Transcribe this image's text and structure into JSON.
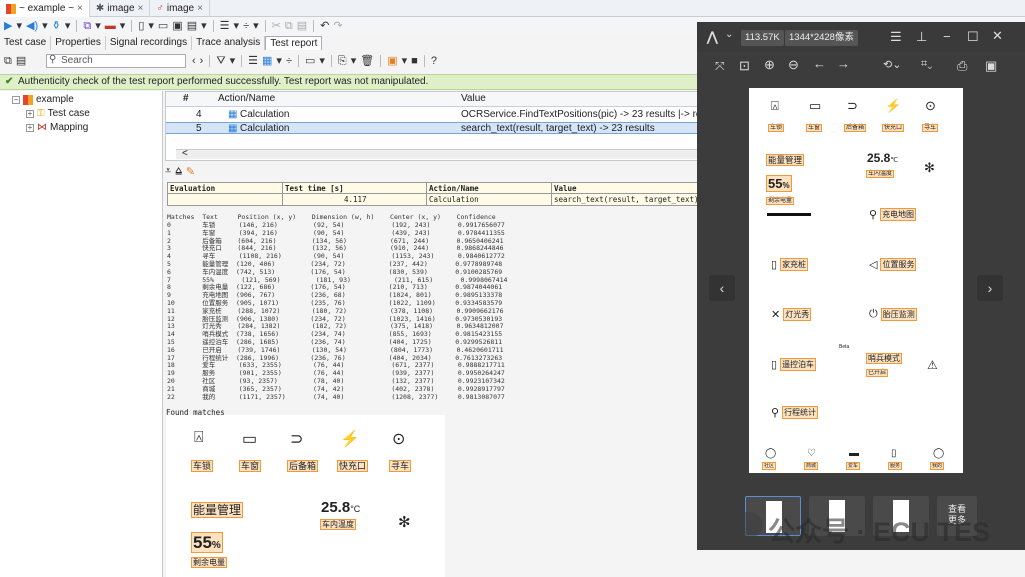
{
  "window_tabs": [
    {
      "label": "~ example ~",
      "icon": "app-grid-icon",
      "active": true
    },
    {
      "label": "image",
      "icon": "image-icon",
      "active": false
    },
    {
      "label": "image",
      "icon": "image-icon",
      "active": false
    }
  ],
  "subtabs": [
    "Test case",
    "Properties",
    "Signal recordings",
    "Trace analysis",
    "Test report"
  ],
  "search": {
    "placeholder": "Search"
  },
  "banner": "Authenticity check of the test report performed successfully. Test report was not manipulated.",
  "tree": {
    "root": "example",
    "children": [
      "Test case",
      "Mapping"
    ]
  },
  "table": {
    "headers": [
      "#",
      "Action/Name",
      "Value"
    ],
    "rows": [
      {
        "num": "4",
        "name": "Calculation",
        "value": "OCRService.FindTextPositions(pic) -> 23 results |-> result"
      },
      {
        "num": "5",
        "name": "Calculation",
        "value": "search_text(result, target_text) -> 23 results"
      }
    ],
    "scroll_arrow": "<",
    "right_header_fragment": "et"
  },
  "evaluation": {
    "headers": [
      "Evaluation",
      "Test time [s]",
      "Action/Name",
      "Value"
    ],
    "row": {
      "eval": "",
      "time": "4.117",
      "action": "Calculation",
      "value": "search_text(result, target_text) -"
    }
  },
  "matches": {
    "header": "Matches  Text     Position (x, y)    Dimension (w, h)    Center (x, y)    Confidence",
    "rows": [
      "0        车锁      (146, 216)         (92, 54)            (192, 243)       0.9917656077",
      "1        车窗      (394, 216)         (90, 54)            (439, 243)       0.9784411355",
      "2        后备箱    (604, 216)         (134, 56)           (671, 244)       0.9650406241",
      "3        快充口    (844, 216)         (132, 56)           (910, 244)       0.9868244846",
      "4        寻车      (1108, 216)        (90, 54)            (1153, 243)      0.9840612772",
      "5        能量管理  (120, 406)         (234, 72)           (237, 442)       0.9778989748",
      "6        车内温度  (742, 513)         (176, 54)           (830, 539)       0.9100285769",
      "7        55%       (121, 569)         (181, 93)           (211, 615)       0.9998067414",
      "8        剩余电量  (122, 686)         (176, 54)           (210, 713)       0.9874044061",
      "9        充电地图  (906, 767)         (236, 68)           (1024, 801)      0.9895133378",
      "10       位置服务  (905, 1071)        (235, 76)           (1022, 1109)     0.9334583579",
      "11       家充桩    (288, 1072)        (180, 72)           (378, 1108)      0.9909662176",
      "12       胎压监测  (906, 1380)        (234, 72)           (1023, 1416)     0.9730530193",
      "13       灯光秀    (284, 1382)        (182, 72)           (375, 1418)      0.9634812007",
      "14       哨兵模式  (738, 1656)        (234, 74)           (855, 1693)      0.9815423155",
      "15       遥控泊车  (286, 1685)        (236, 74)           (404, 1725)      0.9299526811",
      "16       已开启    (739, 1746)        (130, 54)           (804, 1773)      0.4620601711",
      "17       行程统计  (286, 1996)        (236, 76)           (404, 2034)      0.7613273263",
      "18       爱车      (633, 2355)        (76, 44)            (671, 2377)      0.9888217711",
      "19       服务      (901, 2355)        (76, 44)            (939, 2377)      0.9950264247",
      "20       社区      (93, 2357)         (78, 40)            (132, 2377)      0.9923107342",
      "21       商城      (365, 2357)        (74, 42)            (402, 2378)      0.9928917797",
      "22       我的      (1171, 2357)       (74, 40)            (1208, 2377)     0.9813087077"
    ]
  },
  "found_label": "Found matches",
  "shot": {
    "icons": [
      {
        "label": "车锁",
        "icon": "car-lock-icon"
      },
      {
        "label": "车窗",
        "icon": "car-window-icon"
      },
      {
        "label": "后备箱",
        "icon": "trunk-icon"
      },
      {
        "label": "快充口",
        "icon": "fast-charge-icon"
      },
      {
        "label": "寻车",
        "icon": "find-car-icon"
      }
    ],
    "energy": "能量管理",
    "temp": "25.8",
    "temp_unit": "°C",
    "temp_label": "车内温度",
    "battery": "55",
    "battery_unit": "%",
    "battery_label": "剩余电量"
  },
  "viewer": {
    "size": "113.57K",
    "dims": "1344*2428像素",
    "page": {
      "icons": [
        "车锁",
        "车窗",
        "后备箱",
        "快充口",
        "寻车"
      ],
      "energy": "能量管理",
      "temp": "25.8",
      "temp_unit": "℃",
      "temp_label": "车内温度",
      "battery": "55",
      "battery_unit": "%",
      "battery_label": "剩余电量",
      "items": [
        {
          "label": "充电地图",
          "icon": "map-pin-icon"
        },
        {
          "label": "家充桩",
          "icon": "charger-icon"
        },
        {
          "label": "位置服务",
          "icon": "send-icon"
        },
        {
          "label": "灯光秀",
          "icon": "light-icon"
        },
        {
          "label": "胎压监测",
          "icon": "tire-icon"
        },
        {
          "label": "遥控泊车",
          "icon": "remote-park-icon"
        },
        {
          "label": "哨兵模式",
          "icon": "sentry-icon"
        },
        {
          "label": "已开启",
          "icon": ""
        },
        {
          "label": "行程统计",
          "icon": "trip-icon"
        }
      ],
      "beta": "Beta",
      "bottom_nav": [
        "社区",
        "商城",
        "爱车",
        "服务",
        "我的"
      ]
    },
    "more_label_1": "查看",
    "more_label_2": "更多"
  },
  "watermark": "公众号 · ECU TES"
}
